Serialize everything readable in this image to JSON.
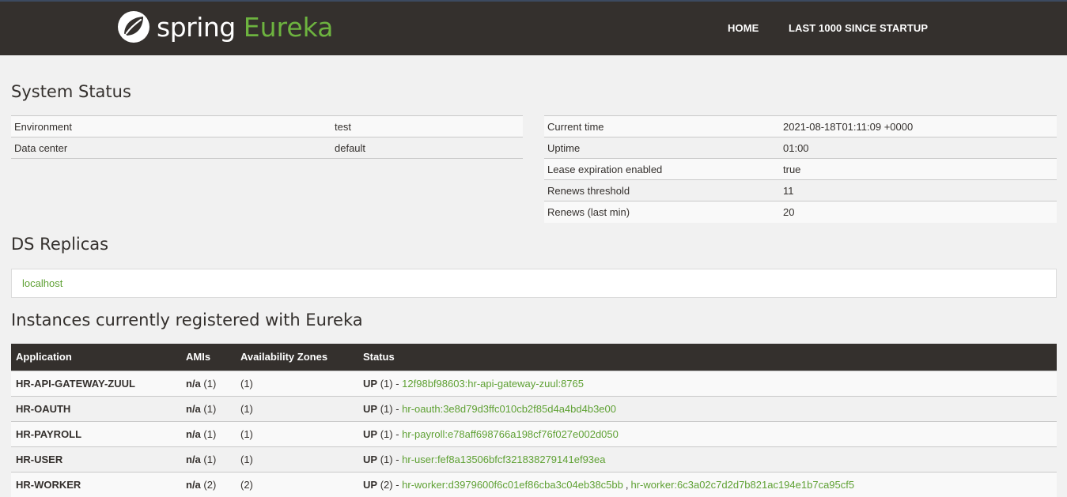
{
  "header": {
    "brand_spring": "spring",
    "brand_eureka": "Eureka",
    "nav": [
      {
        "label": "HOME"
      },
      {
        "label": "LAST 1000 SINCE STARTUP"
      }
    ]
  },
  "system_status": {
    "title": "System Status",
    "left": [
      {
        "key": "Environment",
        "value": "test"
      },
      {
        "key": "Data center",
        "value": "default"
      }
    ],
    "right": [
      {
        "key": "Current time",
        "value": "2021-08-18T01:11:09 +0000"
      },
      {
        "key": "Uptime",
        "value": "01:00"
      },
      {
        "key": "Lease expiration enabled",
        "value": "true"
      },
      {
        "key": "Renews threshold",
        "value": "11"
      },
      {
        "key": "Renews (last min)",
        "value": "20"
      }
    ]
  },
  "ds_replicas": {
    "title": "DS Replicas",
    "items": [
      "localhost"
    ]
  },
  "instances": {
    "title": "Instances currently registered with Eureka",
    "columns": [
      "Application",
      "AMIs",
      "Availability Zones",
      "Status"
    ],
    "rows": [
      {
        "app": "HR-API-GATEWAY-ZUUL",
        "ami_label": "n/a",
        "ami_count": "(1)",
        "zones": "(1)",
        "status": "UP",
        "status_count": "(1) -",
        "links": [
          "12f98bf98603:hr-api-gateway-zuul:8765"
        ]
      },
      {
        "app": "HR-OAUTH",
        "ami_label": "n/a",
        "ami_count": "(1)",
        "zones": "(1)",
        "status": "UP",
        "status_count": "(1) -",
        "links": [
          "hr-oauth:3e8d79d3ffc010cb2f85d4a4bd4b3e00"
        ]
      },
      {
        "app": "HR-PAYROLL",
        "ami_label": "n/a",
        "ami_count": "(1)",
        "zones": "(1)",
        "status": "UP",
        "status_count": "(1) -",
        "links": [
          "hr-payroll:e78aff698766a198cf76f027e002d050"
        ]
      },
      {
        "app": "HR-USER",
        "ami_label": "n/a",
        "ami_count": "(1)",
        "zones": "(1)",
        "status": "UP",
        "status_count": "(1) -",
        "links": [
          "hr-user:fef8a13506bfcf321838279141ef93ea"
        ]
      },
      {
        "app": "HR-WORKER",
        "ami_label": "n/a",
        "ami_count": "(2)",
        "zones": "(2)",
        "status": "UP",
        "status_count": "(2) -",
        "links": [
          "hr-worker:d3979600f6c01ef86cba3c04eb38c5bb",
          "hr-worker:6c3a02c7d2d7b821ac194e1b7ca95cf5"
        ],
        "link_separator": ","
      }
    ]
  },
  "colors": {
    "header_bg": "#34302d",
    "brand_green": "#6db33f",
    "link_green": "#5fa134",
    "page_bg": "#f1f1f1"
  }
}
